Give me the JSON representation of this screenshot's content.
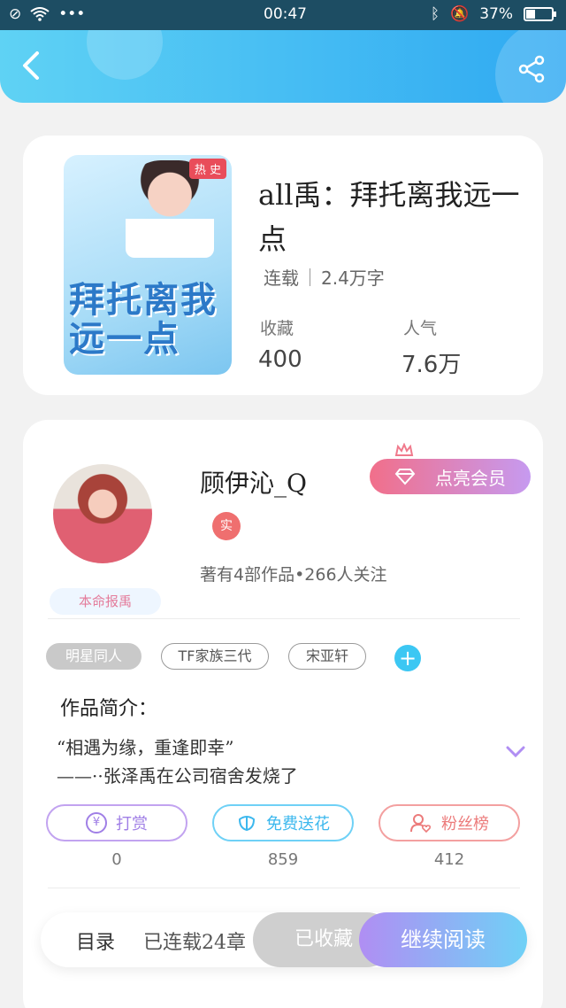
{
  "status_bar": {
    "time": "00:47",
    "battery": "37%"
  },
  "book": {
    "cover_hot_tag": "热 史",
    "cover_title": "拜托离我远一点",
    "title": "all禹：拜托离我远一点",
    "serial_status": "连载",
    "word_count": "2.4万字",
    "collect_label": "收藏",
    "collect_value": "400",
    "popularity_label": "人气",
    "popularity_value": "7.6万"
  },
  "author": {
    "name": "顾伊沁_Q",
    "vip_button": "点亮会员",
    "real_badge": "实",
    "works_info": "著有4部作品•266人关注",
    "rank_tag": "本命报禹",
    "tags": [
      "明星同人",
      "TF家族三代",
      "宋亚轩"
    ],
    "add_tag": "+"
  },
  "intro": {
    "title": "作品简介：",
    "line1": "“相遇为缘，重逢即幸”",
    "line2": "——··张泽禹在公司宿舍发烧了"
  },
  "actions": [
    {
      "label": "打赏",
      "count": "0"
    },
    {
      "label": "免费送花",
      "count": "859"
    },
    {
      "label": "粉丝榜",
      "count": "412"
    }
  ],
  "bottom_bar": {
    "catalog": "目录",
    "chapters": "已连载24章",
    "collected": "已收藏",
    "read": "继续阅读"
  },
  "colors": {
    "accent": "#2fa9f2",
    "pink": "#f16f8a",
    "purple": "#b08ef3"
  }
}
